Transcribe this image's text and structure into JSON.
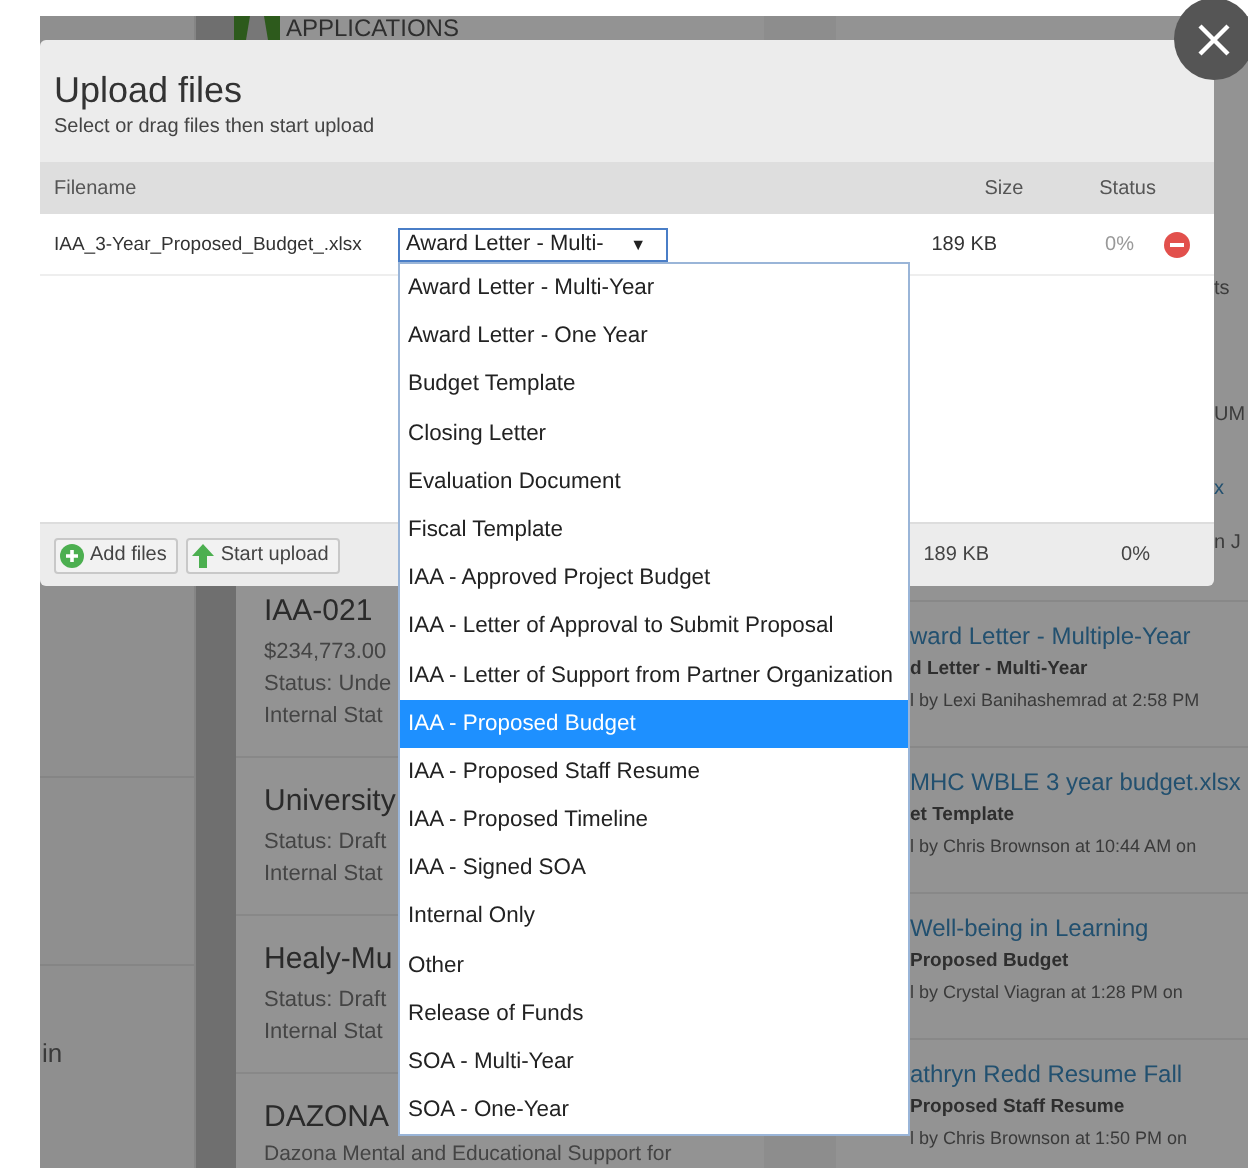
{
  "page": {
    "header_title": "APPLICATIONS",
    "left_panel_text": "in",
    "edge_snippets": [
      {
        "text": "ts",
        "kind": "text"
      },
      {
        "text": "UM",
        "kind": "text"
      },
      {
        "text": "x",
        "kind": "link"
      },
      {
        "text": "n J",
        "kind": "text"
      }
    ],
    "applications": [
      {
        "title": "IAA-021",
        "lines": [
          "$234,773.00",
          "Status: Unde",
          "Internal Stat"
        ]
      },
      {
        "title": "University",
        "lines": [
          "Status: Draft",
          "Internal Stat"
        ]
      },
      {
        "title": "Healy-Mu",
        "lines": [
          "Status: Draft",
          "Internal Stat"
        ]
      },
      {
        "title": "DAZONA",
        "lines": [
          "Dazona Mental and Educational Support for"
        ]
      }
    ],
    "documents": [
      {
        "title": "ward Letter - Multiple-Year",
        "type": "d Letter - Multi-Year",
        "uploaded": "l by Lexi Banihashemrad at 2:58 PM"
      },
      {
        "title": "MHC WBLE 3 year budget.xlsx",
        "type": "et Template",
        "uploaded": "l by Chris Brownson at 10:44 AM on"
      },
      {
        "title": "Well-being in Learning",
        "type": "Proposed Budget",
        "uploaded": "l by Crystal Viagran at 1:28 PM on"
      },
      {
        "title": "athryn Redd Resume Fall",
        "type": "Proposed Staff Resume",
        "uploaded": "l by Chris Brownson at 1:50 PM on"
      }
    ]
  },
  "dialog": {
    "title": "Upload files",
    "subtitle": "Select or drag files then start upload",
    "columns": [
      "Filename",
      "Size",
      "Status"
    ],
    "files": [
      {
        "name": "IAA_3-Year_Proposed_Budget_.xlsx",
        "type": "Award Letter - Multi-",
        "arrow": "▼",
        "size": "189 KB",
        "status": "0%"
      }
    ],
    "buttons": [
      {
        "label": "Add files"
      },
      {
        "label": "Start upload"
      }
    ],
    "total_size": "189 KB",
    "total_status": "0%"
  },
  "dropdown": {
    "options": [
      {
        "label": "Award Letter - Multi-Year",
        "selected": false
      },
      {
        "label": "Award Letter - One Year",
        "selected": false
      },
      {
        "label": "Budget Template",
        "selected": false
      },
      {
        "label": "Closing Letter",
        "selected": false
      },
      {
        "label": "Evaluation Document",
        "selected": false
      },
      {
        "label": "Fiscal Template",
        "selected": false
      },
      {
        "label": "IAA - Approved Project Budget",
        "selected": false
      },
      {
        "label": "IAA - Letter of Approval to Submit Proposal",
        "selected": false
      },
      {
        "label": "IAA - Letter of Support from Partner Organization",
        "selected": false
      },
      {
        "label": "IAA - Proposed Budget",
        "selected": true
      },
      {
        "label": "IAA - Proposed Staff Resume",
        "selected": false
      },
      {
        "label": "IAA - Proposed Timeline",
        "selected": false
      },
      {
        "label": "IAA - Signed SOA",
        "selected": false
      },
      {
        "label": "Internal Only",
        "selected": false
      },
      {
        "label": "Other",
        "selected": false
      },
      {
        "label": "Release of Funds",
        "selected": false
      },
      {
        "label": "SOA - Multi-Year",
        "selected": false
      },
      {
        "label": "SOA - One-Year",
        "selected": false
      }
    ]
  }
}
